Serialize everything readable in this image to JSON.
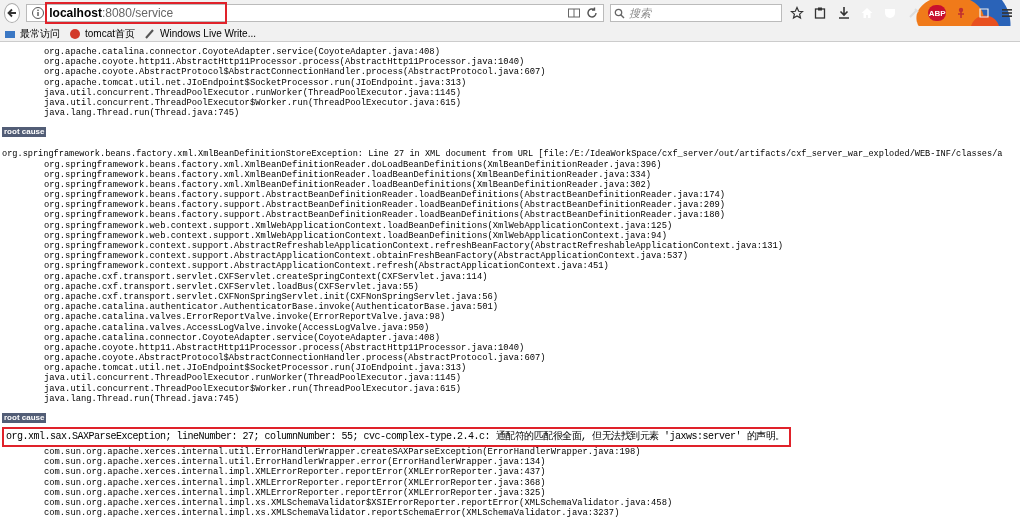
{
  "browser": {
    "url": {
      "host": "localhost",
      "path": ":8080/service",
      "highlighted": true
    },
    "search": {
      "placeholder": "搜索"
    },
    "addon_badge": "ABP",
    "bookmarks": [
      "最常访问",
      "tomcat首页",
      "Windows Live Write..."
    ]
  },
  "blocks": [
    {
      "kind": "frames",
      "lines": [
        "org.apache.catalina.connector.CoyoteAdapter.service(CoyoteAdapter.java:408)",
        "org.apache.coyote.http11.AbstractHttp11Processor.process(AbstractHttp11Processor.java:1040)",
        "org.apache.coyote.AbstractProtocol$AbstractConnectionHandler.process(AbstractProtocol.java:607)",
        "org.apache.tomcat.util.net.JIoEndpoint$SocketProcessor.run(JIoEndpoint.java:313)",
        "java.util.concurrent.ThreadPoolExecutor.runWorker(ThreadPoolExecutor.java:1145)",
        "java.util.concurrent.ThreadPoolExecutor$Worker.run(ThreadPoolExecutor.java:615)",
        "java.lang.Thread.run(Thread.java:745)"
      ]
    },
    {
      "kind": "label",
      "text": "root cause"
    },
    {
      "kind": "message",
      "text": "org.springframework.beans.factory.xml.XmlBeanDefinitionStoreException: Line 27 in XML document from URL [file:/E:/IdeaWorkSpace/cxf_server/out/artifacts/cxf_server_war_exploded/WEB-INF/classes/a",
      "highlighted": false
    },
    {
      "kind": "frames",
      "lines": [
        "org.springframework.beans.factory.xml.XmlBeanDefinitionReader.doLoadBeanDefinitions(XmlBeanDefinitionReader.java:396)",
        "org.springframework.beans.factory.xml.XmlBeanDefinitionReader.loadBeanDefinitions(XmlBeanDefinitionReader.java:334)",
        "org.springframework.beans.factory.xml.XmlBeanDefinitionReader.loadBeanDefinitions(XmlBeanDefinitionReader.java:302)",
        "org.springframework.beans.factory.support.AbstractBeanDefinitionReader.loadBeanDefinitions(AbstractBeanDefinitionReader.java:174)",
        "org.springframework.beans.factory.support.AbstractBeanDefinitionReader.loadBeanDefinitions(AbstractBeanDefinitionReader.java:209)",
        "org.springframework.beans.factory.support.AbstractBeanDefinitionReader.loadBeanDefinitions(AbstractBeanDefinitionReader.java:180)",
        "org.springframework.web.context.support.XmlWebApplicationContext.loadBeanDefinitions(XmlWebApplicationContext.java:125)",
        "org.springframework.web.context.support.XmlWebApplicationContext.loadBeanDefinitions(XmlWebApplicationContext.java:94)",
        "org.springframework.context.support.AbstractRefreshableApplicationContext.refreshBeanFactory(AbstractRefreshableApplicationContext.java:131)",
        "org.springframework.context.support.AbstractApplicationContext.obtainFreshBeanFactory(AbstractApplicationContext.java:537)",
        "org.springframework.context.support.AbstractApplicationContext.refresh(AbstractApplicationContext.java:451)",
        "org.apache.cxf.transport.servlet.CXFServlet.createSpringContext(CXFServlet.java:114)",
        "org.apache.cxf.transport.servlet.CXFServlet.loadBus(CXFServlet.java:55)",
        "org.apache.cxf.transport.servlet.CXFNonSpringServlet.init(CXFNonSpringServlet.java:56)",
        "org.apache.catalina.authenticator.AuthenticatorBase.invoke(AuthenticatorBase.java:501)",
        "org.apache.catalina.valves.ErrorReportValve.invoke(ErrorReportValve.java:98)",
        "org.apache.catalina.valves.AccessLogValve.invoke(AccessLogValve.java:950)",
        "org.apache.catalina.connector.CoyoteAdapter.service(CoyoteAdapter.java:408)",
        "org.apache.coyote.http11.AbstractHttp11Processor.process(AbstractHttp11Processor.java:1040)",
        "org.apache.coyote.AbstractProtocol$AbstractConnectionHandler.process(AbstractProtocol.java:607)",
        "org.apache.tomcat.util.net.JIoEndpoint$SocketProcessor.run(JIoEndpoint.java:313)",
        "java.util.concurrent.ThreadPoolExecutor.runWorker(ThreadPoolExecutor.java:1145)",
        "java.util.concurrent.ThreadPoolExecutor$Worker.run(ThreadPoolExecutor.java:615)",
        "java.lang.Thread.run(Thread.java:745)"
      ]
    },
    {
      "kind": "label",
      "text": "root cause"
    },
    {
      "kind": "message",
      "text": "org.xml.sax.SAXParseException; lineNumber: 27; columnNumber: 55; cvc-complex-type.2.4.c: 通配符的匹配很全面, 但无法找到元素 'jaxws:server' 的声明。",
      "highlighted": true
    },
    {
      "kind": "frames",
      "lines": [
        "com.sun.org.apache.xerces.internal.util.ErrorHandlerWrapper.createSAXParseException(ErrorHandlerWrapper.java:198)",
        "com.sun.org.apache.xerces.internal.util.ErrorHandlerWrapper.error(ErrorHandlerWrapper.java:134)",
        "com.sun.org.apache.xerces.internal.impl.XMLErrorReporter.reportError(XMLErrorReporter.java:437)",
        "com.sun.org.apache.xerces.internal.impl.XMLErrorReporter.reportError(XMLErrorReporter.java:368)",
        "com.sun.org.apache.xerces.internal.impl.XMLErrorReporter.reportError(XMLErrorReporter.java:325)",
        "com.sun.org.apache.xerces.internal.impl.xs.XMLSchemaValidator$XSIErrorReporter.reportError(XMLSchemaValidator.java:458)",
        "com.sun.org.apache.xerces.internal.impl.xs.XMLSchemaValidator.reportSchemaError(XMLSchemaValidator.java:3237)"
      ]
    }
  ]
}
